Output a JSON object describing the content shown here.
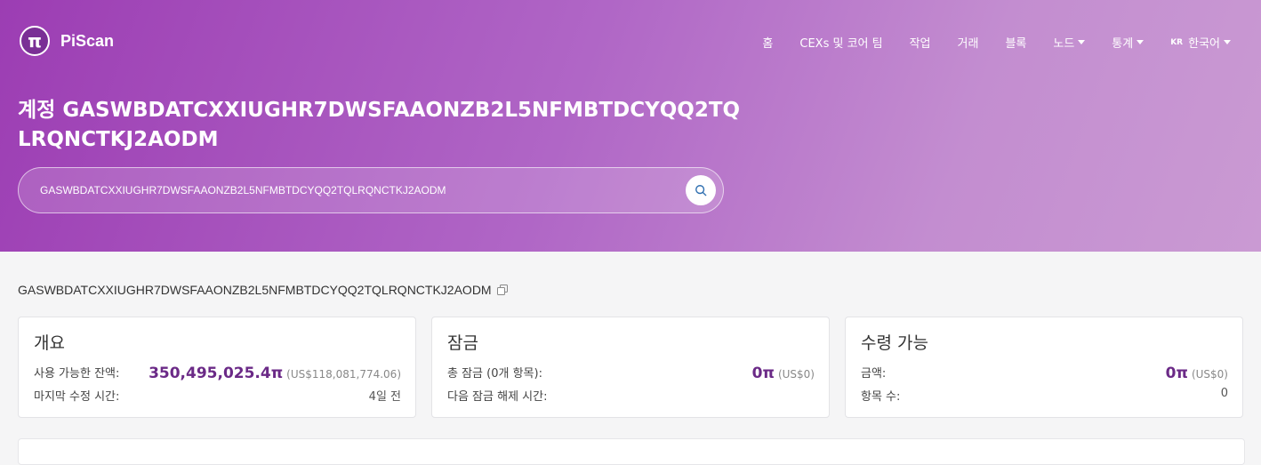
{
  "brand": {
    "name": "PiScan",
    "logo_glyph": "π"
  },
  "nav": {
    "items": [
      {
        "label": "홈"
      },
      {
        "label": "CEXs 및 코어 팀"
      },
      {
        "label": "작업"
      },
      {
        "label": "거래"
      },
      {
        "label": "블록"
      },
      {
        "label": "노드"
      },
      {
        "label": "통계"
      }
    ],
    "lang_flag": "KR",
    "lang_label": "한국어"
  },
  "page": {
    "title": "계정 GASWBDATCXXIUGHR7DWSFAAONZB2L5NFMBTDCYQQ2TQLRQNCTKJ2AODM"
  },
  "search": {
    "value": "GASWBDATCXXIUGHR7DWSFAAONZB2L5NFMBTDCYQQ2TQLRQNCTKJ2AODM"
  },
  "account": {
    "address": "GASWBDATCXXIUGHR7DWSFAAONZB2L5NFMBTDCYQQ2TQLRQNCTKJ2AODM"
  },
  "cards": {
    "overview": {
      "title": "개요",
      "balance_label": "사용 가능한 잔액:",
      "balance_value": "350,495,025.4π",
      "balance_usd": "(US$118,081,774.06)",
      "modified_label": "마지막 수정 시간:",
      "modified_value": "4일 전"
    },
    "locked": {
      "title": "잠금",
      "total_label": "총 잠금 (0개 항목):",
      "total_value": "0π",
      "total_usd": "(US$0)",
      "next_unlock_label": "다음 잠금 해제 시간:"
    },
    "claimable": {
      "title": "수령 가능",
      "amount_label": "금액:",
      "amount_value": "0π",
      "amount_usd": "(US$0)",
      "count_label": "항목 수:",
      "count_value": "0"
    }
  },
  "colors": {
    "accent": "#6b2a87",
    "hero_gradient_start": "#9c3db3",
    "hero_gradient_end": "#ca9ad3"
  }
}
